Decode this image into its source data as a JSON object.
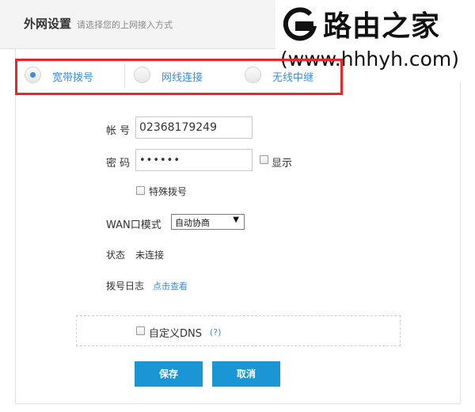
{
  "header": {
    "title": "外网设置",
    "subtitle": "请选择您的上网接入方式"
  },
  "watermark": {
    "title": "路由之家",
    "url": "(www.hhhyh.com)"
  },
  "tabs": [
    {
      "label": "宽带拨号",
      "selected": true
    },
    {
      "label": "网线连接",
      "selected": false
    },
    {
      "label": "无线中继",
      "selected": false
    }
  ],
  "form": {
    "account_label": "帐 号",
    "account_value": "02368179249",
    "password_label": "密 码",
    "password_value": "••••••",
    "show_label": "显示",
    "special_dial_label": "特殊拨号",
    "wan_mode_label": "WAN口模式",
    "wan_mode_value": "自动协商",
    "status_label": "状态",
    "status_value": "未连接",
    "dial_log_label": "拨号日志",
    "dial_log_link": "点击查看",
    "custom_dns_label": "自定义DNS",
    "dns_help": "(?)"
  },
  "buttons": {
    "save": "保存",
    "cancel": "取消"
  },
  "colors": {
    "accent": "#1a96d4",
    "link": "#3a8ee0",
    "highlight_border": "#e8262b"
  }
}
